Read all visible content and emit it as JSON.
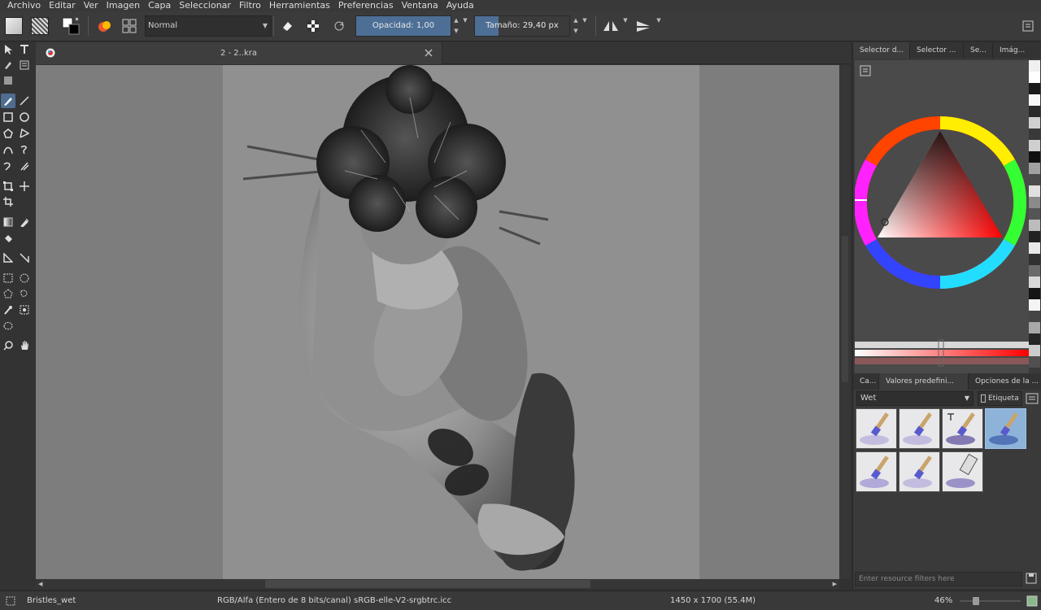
{
  "menu": [
    {
      "label": "Archivo"
    },
    {
      "label": "Editar"
    },
    {
      "label": "Ver"
    },
    {
      "label": "Imagen"
    },
    {
      "label": "Capa"
    },
    {
      "label": "Seleccionar"
    },
    {
      "label": "Filtro"
    },
    {
      "label": "Herramientas"
    },
    {
      "label": "Preferencias"
    },
    {
      "label": "Ventana"
    },
    {
      "label": "Ayuda"
    }
  ],
  "toolbar": {
    "blend_mode": "Normal",
    "opacity_label": "Opacidad:  1,00",
    "opacity_fraction": 1.0,
    "size_label": "Tamaño:  29,40 px",
    "size_fraction": 0.25
  },
  "document": {
    "tab_title": "2 - 2..kra"
  },
  "docker": {
    "top_tabs": [
      "Selector d...",
      "Selector ...",
      "Se...",
      "Imág..."
    ],
    "preset_tabs": [
      "Ca...",
      "Valores predefini...",
      "Opciones de la ..."
    ],
    "preset_filter": "Wet",
    "tag_label": "Etiqueta",
    "resource_filter_placeholder": "Enter resource filters here",
    "selected_preset_index": 3,
    "swatches": [
      "#f0f0f0",
      "#ffffff",
      "#1a1a1a",
      "#f8f8f8",
      "#2a2a2a",
      "#d0d0d0",
      "#383838",
      "#cfcfcf",
      "#101010",
      "#a0a0a0",
      "#4a4a4a",
      "#e0e0e0",
      "#8a8a8a",
      "#555555",
      "#bcbcbc",
      "#222222",
      "#e8e8e8",
      "#303030",
      "#6a6a6a",
      "#d8d8d8",
      "#151515",
      "#f4f4f4",
      "#454545",
      "#a8a8a8",
      "#262626",
      "#cccccc",
      "#505050"
    ]
  },
  "status": {
    "brush": "Bristles_wet",
    "color_space": "RGB/Alfa (Entero de 8 bits/canal)  sRGB-elle-V2-srgbtrc.icc",
    "dimensions": "1450 x 1700 (55.4M)",
    "zoom": "46%"
  },
  "colors": {
    "accent": "#4e6d8f",
    "background": "#313131",
    "canvas_bg": "#7d7d7d",
    "paper": "#909090"
  }
}
